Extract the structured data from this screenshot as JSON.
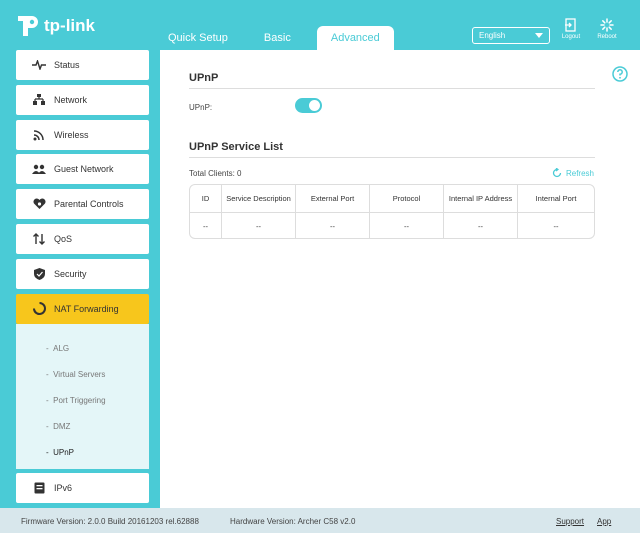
{
  "header": {
    "logo_text": "tp-link",
    "tabs": [
      {
        "label": "Quick Setup"
      },
      {
        "label": "Basic"
      },
      {
        "label": "Advanced"
      }
    ],
    "language": "English",
    "logout_label": "Logout",
    "reboot_label": "Reboot"
  },
  "sidebar": {
    "items": [
      {
        "label": "Status",
        "icon": "pulse-icon"
      },
      {
        "label": "Network",
        "icon": "network-icon"
      },
      {
        "label": "Wireless",
        "icon": "wifi-icon"
      },
      {
        "label": "Guest Network",
        "icon": "guest-users-icon"
      },
      {
        "label": "Parental Controls",
        "icon": "heart-icon"
      },
      {
        "label": "QoS",
        "icon": "arrows-updown-icon"
      },
      {
        "label": "Security",
        "icon": "shield-icon"
      },
      {
        "label": "NAT Forwarding",
        "icon": "nat-forwarding-icon"
      },
      {
        "label": "IPv6",
        "icon": "ipv6-icon"
      }
    ],
    "submenu": [
      {
        "label": "ALG"
      },
      {
        "label": "Virtual Servers"
      },
      {
        "label": "Port Triggering"
      },
      {
        "label": "DMZ"
      },
      {
        "label": "UPnP"
      }
    ]
  },
  "main": {
    "upnp_title": "UPnP",
    "upnp_label": "UPnP:",
    "upnp_enabled": true,
    "service_list_title": "UPnP Service List",
    "total_clients": "Total Clients: 0",
    "refresh_label": "Refresh",
    "table": {
      "headers": [
        "ID",
        "Service Description",
        "External Port",
        "Protocol",
        "Internal IP Address",
        "Internal Port"
      ],
      "rows": [
        [
          "--",
          "--",
          "--",
          "--",
          "--",
          "--"
        ]
      ]
    }
  },
  "footer": {
    "firmware": "Firmware Version: 2.0.0 Build 20161203 rel.62888",
    "hardware": "Hardware Version: Archer C58 v2.0",
    "support": "Support",
    "app": "App"
  },
  "colors": {
    "brand": "#4acbd6",
    "active_menu": "#f7c61c",
    "submenu_bg": "#e4f6f8",
    "footer_bg": "#d8e7ec"
  }
}
